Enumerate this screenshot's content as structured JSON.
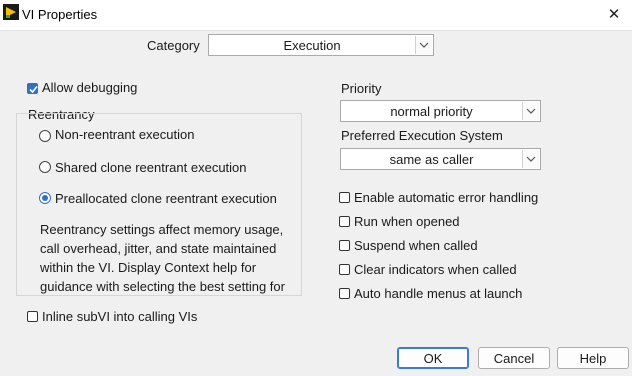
{
  "window": {
    "title": "VI Properties",
    "icon": "vi-icon",
    "close_symbol": "✕"
  },
  "category": {
    "label": "Category",
    "value": "Execution"
  },
  "allow_debugging": {
    "label": "Allow debugging",
    "checked": true
  },
  "reentrancy": {
    "title": "Reentrancy",
    "options": [
      {
        "label": "Non-reentrant execution",
        "selected": false
      },
      {
        "label": "Shared clone reentrant execution",
        "selected": false
      },
      {
        "label": "Preallocated clone reentrant execution",
        "selected": true
      }
    ],
    "description": [
      "Reentrancy settings affect memory usage,",
      "call overhead, jitter, and state maintained",
      "within the VI. Display Context help for",
      "guidance with selecting the best setting for"
    ]
  },
  "inline_subvi": {
    "label": "Inline subVI into calling VIs",
    "checked": false
  },
  "priority": {
    "label": "Priority",
    "value": "normal priority"
  },
  "execution_system": {
    "label": "Preferred Execution System",
    "value": "same as caller"
  },
  "options": [
    {
      "label": "Enable automatic error handling",
      "checked": false
    },
    {
      "label": "Run when opened",
      "checked": false
    },
    {
      "label": "Suspend when called",
      "checked": false
    },
    {
      "label": "Clear indicators when called",
      "checked": false
    },
    {
      "label": "Auto handle menus at launch",
      "checked": false
    }
  ],
  "buttons": {
    "ok": "OK",
    "cancel": "Cancel",
    "help": "Help"
  },
  "colors": {
    "accent": "#2f6fc8",
    "background": "#f0f0f0"
  }
}
